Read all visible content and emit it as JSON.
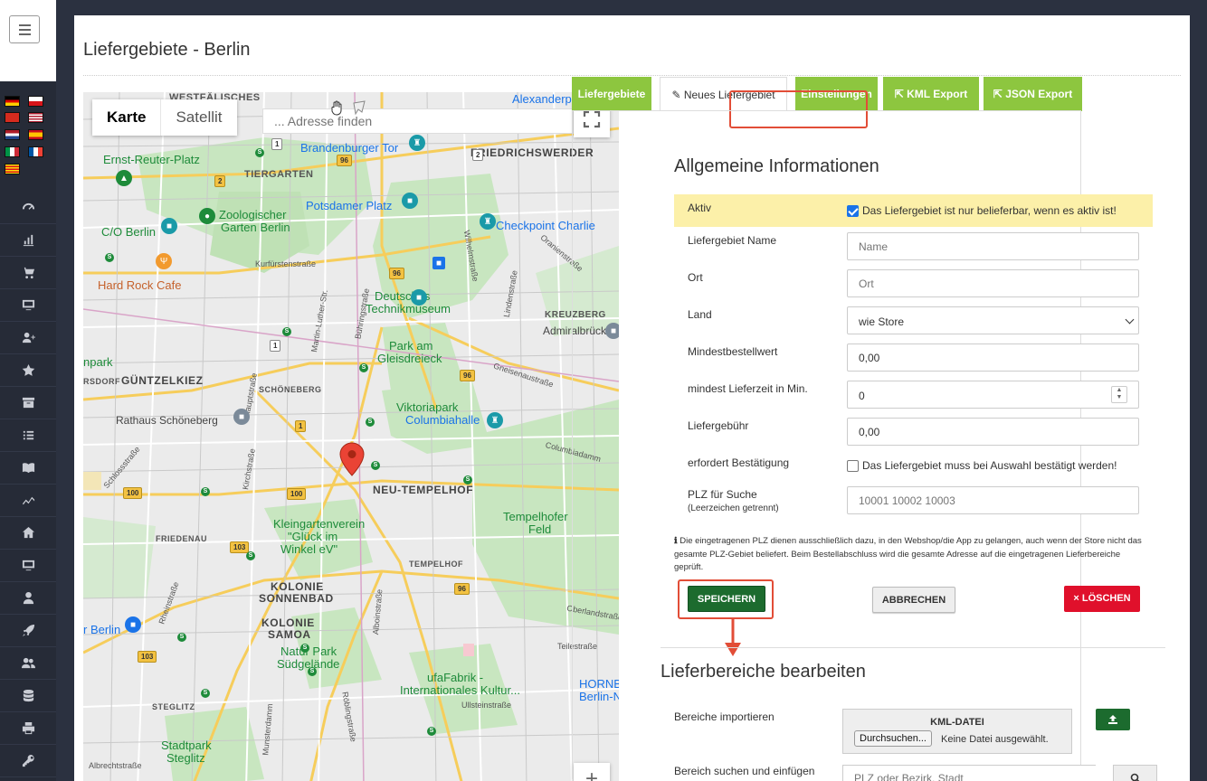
{
  "page": {
    "title": "Liefergebiete - Berlin"
  },
  "map": {
    "maptype_karte": "Karte",
    "maptype_satellit": "Satellit",
    "address_placeholder": "... Adresse finden",
    "labels": [
      "WESTFÄLISCHES",
      "Alexanderplatz",
      "Brandenburger Tor",
      "Ernst-Reuter-Platz",
      "TIERGARTEN",
      "FRIEDRICHSWERDER",
      "Zoologischer",
      "Garten Berlin",
      "Potsdamer Platz",
      "Checkpoint Charlie",
      "C/O Berlin",
      "Hard Rock Cafe",
      "Kurfürstenstraße",
      "Deutsches",
      "Technikmuseum",
      "KREUZBERG",
      "Admiralbrücke",
      "Park am",
      "Gleisdreieck",
      "GÜNTZELKIEZ",
      "npark",
      "SCHÖNEBERG",
      "Gneisenaustraße",
      "Viktoriapark",
      "Columbiahalle",
      "Rathaus Schöneberg",
      "NEU-TEMPELHOF",
      "Columbiadamm",
      "Tempelhofer",
      "Feld",
      "Kleingartenverein",
      "\"Glück im",
      "Winkel eV\"",
      "FRIEDENAU",
      "TEMPELHOF",
      "KOLONIE",
      "SONNENBAD",
      "KOLONIE",
      "SAMOA",
      "Natur Park",
      "Südgelände",
      "r Berlin",
      "ufaFabrik -",
      "Internationales Kultur...",
      "HORNBA",
      "Berlin-Neuk",
      "STEGLITZ",
      "Stadtpark",
      "Steglitz",
      "Oberlandstraße",
      "Teilestraße",
      "Ullsteinstraße",
      "Albrechtstraße",
      "Rheinstraße",
      "Munsterdamm",
      "Hauptstraße",
      "Martin-Luther-Str.",
      "Oranienstraße",
      "Wilhelmstraße",
      "Lindenstraße",
      "Schlossstraße",
      "Kirchstraße",
      "Alboinstraße",
      "Röblingstraße",
      "RSDORF",
      "Bühringstraße"
    ],
    "road_badges": [
      "96",
      "2",
      "2",
      "96",
      "1",
      "96",
      "1",
      "100",
      "103",
      "100",
      "96",
      "103",
      "1"
    ]
  },
  "tabs": [
    {
      "label": "Liefergebiete",
      "active": false
    },
    {
      "label": "Neues Liefergebiet",
      "active": true
    },
    {
      "label": "Einstellungen",
      "active": false
    },
    {
      "label": "KML Export",
      "active": false
    },
    {
      "label": "JSON Export",
      "active": false
    }
  ],
  "form": {
    "section_title": "Allgemeine Informationen",
    "active_label": "Aktiv",
    "active_checkbox_text": "Das Liefergebiet ist nur belieferbar, wenn es aktiv ist!",
    "name_label": "Liefergebiet Name",
    "name_placeholder": "Name",
    "ort_label": "Ort",
    "ort_placeholder": "Ort",
    "land_label": "Land",
    "land_value": "wie Store",
    "min_order_label": "Mindestbestellwert",
    "min_order_value": "0,00",
    "min_time_label": "mindest Lieferzeit in Min.",
    "min_time_value": "0",
    "fee_label": "Liefergebühr",
    "fee_value": "0,00",
    "confirm_label": "erfordert Bestätigung",
    "confirm_checkbox_text": "Das Liefergebiet muss bei Auswahl bestätigt werden!",
    "plz_label": "PLZ für Suche",
    "plz_sublabel": "(Leerzeichen getrennt)",
    "plz_placeholder": "10001 10002 10003",
    "note": "Die eingetragenen PLZ dienen ausschließlich dazu, in den Webshop/die App zu gelangen, auch wenn der Store nicht das gesamte PLZ-Gebiet beliefert. Beim Bestellabschluss wird die gesamte Adresse auf die eingetragenen Lieferbereiche geprüft.",
    "save_label": "SPEICHERN",
    "cancel_label": "ABBRECHEN",
    "delete_label": "LÖSCHEN"
  },
  "areas": {
    "section_title": "Lieferbereiche bearbeiten",
    "import_label": "Bereiche importieren",
    "kml_title": "KML-DATEI",
    "browse_label": "Durchsuchen...",
    "file_status": "Keine Datei ausgewählt.",
    "search_label": "Bereich suchen und einfügen",
    "search_placeholder": "PLZ oder Bezirk, Stadt"
  },
  "colors": {
    "sidebar": "#262b37",
    "tab_green": "#8dc63f",
    "save_green": "#1c6b2e",
    "delete_red": "#e0102b",
    "highlight_red": "#e24d37",
    "active_row": "#fcf0a9"
  }
}
